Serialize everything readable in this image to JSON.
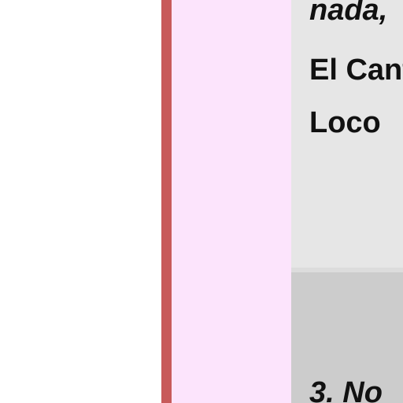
{
  "colors": {
    "background": "#ffffff",
    "accent_bar": "#c85a5a",
    "pink_panel": "#fce4fc",
    "content_light": "#e6e6e6",
    "separator": "#dcdcdc",
    "content_dark": "#cccccc",
    "text": "#111111"
  },
  "content": {
    "line_top": "nada,",
    "line_title_1": "El Cant",
    "line_title_2": "Loco",
    "line_bottom": "3. No"
  }
}
